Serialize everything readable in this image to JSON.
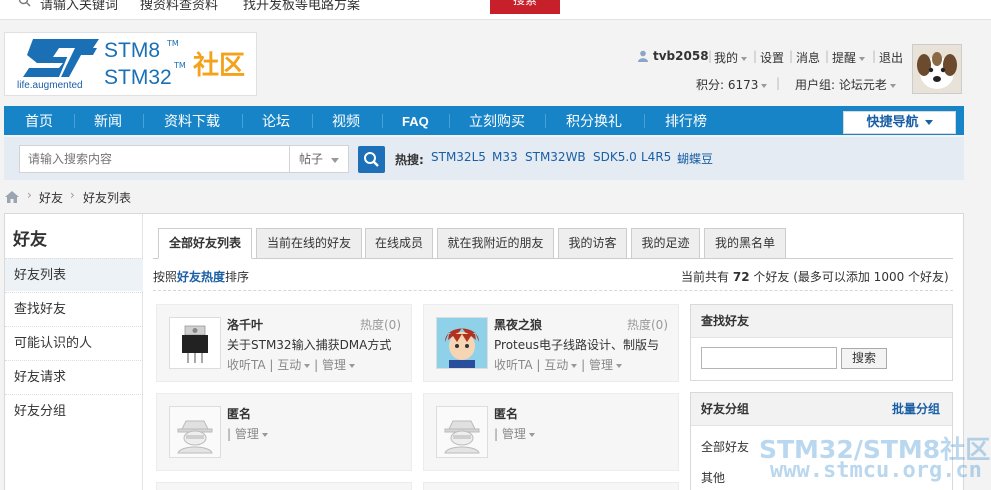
{
  "topbar": {
    "search_hint": "请输入关键词",
    "suggestion_1": "搜资料查资料",
    "suggestion_2": "找开发板等电路方案",
    "search_button": "搜索"
  },
  "logo": {
    "tagline": "life.augmented",
    "line1": "STM8",
    "line2": "STM32",
    "tm": "TM",
    "community": "社区"
  },
  "user": {
    "username": "tvb2058",
    "links": [
      "我的",
      "设置",
      "消息",
      "提醒",
      "退出"
    ],
    "points": "积分: 6173",
    "group": "用户组: 论坛元老"
  },
  "nav": {
    "items": [
      "首页",
      "新闻",
      "资料下载",
      "论坛",
      "视频",
      "FAQ",
      "立刻购买",
      "积分换礼",
      "排行榜"
    ],
    "quick_nav": "快捷导航"
  },
  "search": {
    "placeholder": "请输入搜索内容",
    "type": "帖子",
    "hot_label": "热搜:",
    "hot_terms": [
      "STM32L5",
      "M33",
      "STM32WB",
      "SDK5.0",
      "L4R5",
      "蝴蝶豆"
    ]
  },
  "breadcrumb": [
    "好友",
    "好友列表"
  ],
  "sidebar": {
    "title": "好友",
    "items": [
      "好友列表",
      "查找好友",
      "可能认识的人",
      "好友请求",
      "好友分组"
    ]
  },
  "tabs": [
    "全部好友列表",
    "当前在线的好友",
    "在线成员",
    "就在我附近的朋友",
    "我的访客",
    "我的足迹",
    "我的黑名单"
  ],
  "sort": {
    "prefix": "按照",
    "key": "好友热度",
    "suffix": "排序"
  },
  "count": {
    "prefix": "当前共有",
    "number": "72",
    "suffix": "个好友 (最多可以添加 1000 个好友)"
  },
  "friends": [
    {
      "name": "洛千叶",
      "heat": "热度(0)",
      "desc": "关于STM32输入捕获DMA方式",
      "actions": [
        "收听TA",
        "互动",
        "管理"
      ]
    },
    {
      "name": "黑夜之狼",
      "heat": "热度(0)",
      "desc": "Proteus电子线路设计、制版与",
      "actions": [
        "收听TA",
        "互动",
        "管理"
      ]
    },
    {
      "name": "匿名",
      "actions": [
        "管理"
      ]
    },
    {
      "name": "匿名",
      "actions": [
        "管理"
      ]
    }
  ],
  "find_box": {
    "title": "查找好友",
    "button": "搜索"
  },
  "group_box": {
    "title": "好友分组",
    "link": "批量分组",
    "groups": [
      "全部好友",
      "其他"
    ]
  },
  "watermark": {
    "line1": "STM32/STM8社区",
    "line2": "www.stmcu.org.cn"
  },
  "colors": {
    "nav_blue": "#1784c7",
    "link_blue": "#1a5fa5",
    "search_red": "#c8202a",
    "community_orange": "#f4a21c"
  }
}
